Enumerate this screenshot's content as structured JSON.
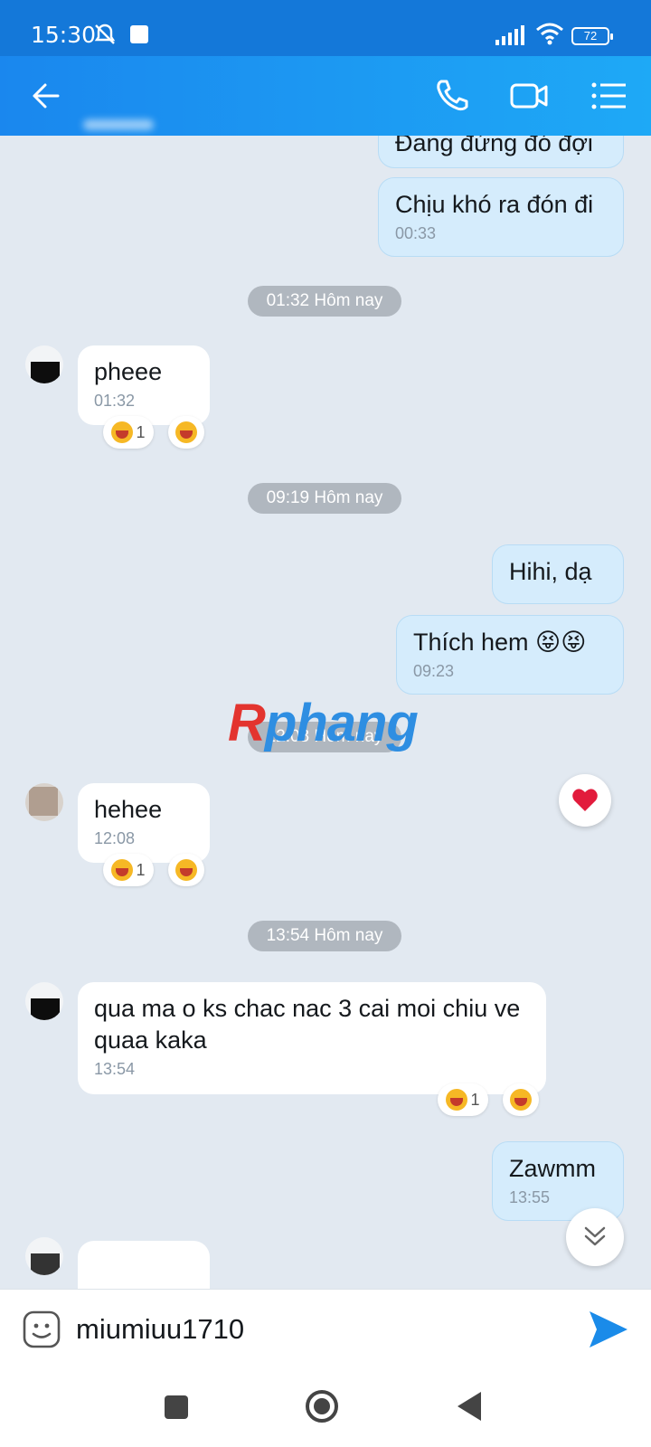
{
  "status_bar": {
    "time": "15:30",
    "battery": "72"
  },
  "header": {
    "icons": [
      "back-arrow-icon",
      "phone-icon",
      "video-icon",
      "list-menu-icon"
    ]
  },
  "messages": [
    {
      "dir": "out",
      "text": "Đang đứng đó đợi",
      "time": ""
    },
    {
      "dir": "out",
      "text": "Chịu khó ra đón đi",
      "time": "00:33"
    },
    {
      "type": "date",
      "label": "01:32 Hôm nay"
    },
    {
      "dir": "in",
      "text": "pheee",
      "time": "01:32",
      "reaction_count": "1"
    },
    {
      "type": "date",
      "label": "09:19 Hôm nay"
    },
    {
      "dir": "out",
      "text": "Hihi, dạ",
      "time": ""
    },
    {
      "dir": "out",
      "text": "Thích hem 😝😝",
      "time": "09:23"
    },
    {
      "type": "date",
      "label": "12:08 Hôm nay"
    },
    {
      "dir": "in",
      "text": "hehee",
      "time": "12:08",
      "reaction_count": "1"
    },
    {
      "type": "date",
      "label": "13:54 Hôm nay"
    },
    {
      "dir": "in",
      "text": "qua ma o ks chac nac 3 cai moi chiu ve quaa kaka",
      "time": "13:54",
      "reaction_count": "1"
    },
    {
      "dir": "out",
      "text": "Zawmm",
      "time": "13:55"
    }
  ],
  "watermark": {
    "r": "R",
    "rest": "phang"
  },
  "input": {
    "value": "miumiuu1710"
  },
  "colors": {
    "header": "#1a87ee",
    "out_bubble": "#d5ecfc",
    "in_bubble": "#ffffff",
    "background": "#e2e9f1"
  }
}
